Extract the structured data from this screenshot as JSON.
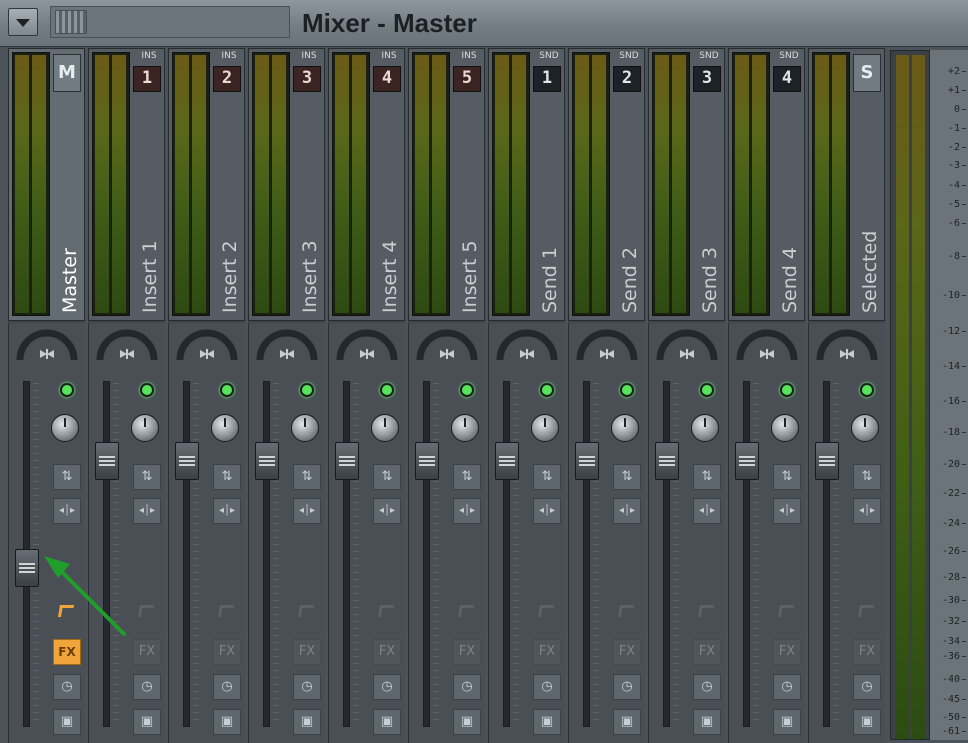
{
  "window": {
    "title": "Mixer - Master"
  },
  "strips": [
    {
      "name": "Master",
      "route_tag": "",
      "route_value": "M",
      "kind": "master",
      "selected": true
    },
    {
      "name": "Insert 1",
      "route_tag": "INS",
      "route_value": "1",
      "kind": "insert"
    },
    {
      "name": "Insert 2",
      "route_tag": "INS",
      "route_value": "2",
      "kind": "insert"
    },
    {
      "name": "Insert 3",
      "route_tag": "INS",
      "route_value": "3",
      "kind": "insert"
    },
    {
      "name": "Insert 4",
      "route_tag": "INS",
      "route_value": "4",
      "kind": "insert"
    },
    {
      "name": "Insert 5",
      "route_tag": "INS",
      "route_value": "5",
      "kind": "insert"
    },
    {
      "name": "Send 1",
      "route_tag": "SND",
      "route_value": "1",
      "kind": "send"
    },
    {
      "name": "Send 2",
      "route_tag": "SND",
      "route_value": "2",
      "kind": "send"
    },
    {
      "name": "Send 3",
      "route_tag": "SND",
      "route_value": "3",
      "kind": "send"
    },
    {
      "name": "Send 4",
      "route_tag": "SND",
      "route_value": "4",
      "kind": "send"
    },
    {
      "name": "Selected",
      "route_tag": "",
      "route_value": "S",
      "kind": "selected"
    }
  ],
  "fx_label": "FX",
  "fader_levels": {
    "master": 0.45,
    "others": 0.8
  },
  "meter_scale": [
    "+2",
    "+1",
    "0",
    "-1",
    "-2",
    "-3",
    "-4",
    "-5",
    "-6",
    "-8",
    "-10",
    "-12",
    "-14",
    "-16",
    "-18",
    "-20",
    "-22",
    "-24",
    "-26",
    "-28",
    "-30",
    "-32",
    "-34",
    "-36",
    "-40",
    "-45",
    "-50",
    "-61"
  ],
  "colors": {
    "fx_active": "#f1a43a",
    "led_on": "#58e35d",
    "annotation_arrow": "#1f9e2b"
  },
  "icons": {
    "menu": "triangle-down-icon",
    "pan": "bowtie-icon",
    "swap": "swap-arrows-icon",
    "stereo": "stereo-separation-icon",
    "clock": "clock-icon",
    "save": "disk-icon"
  }
}
